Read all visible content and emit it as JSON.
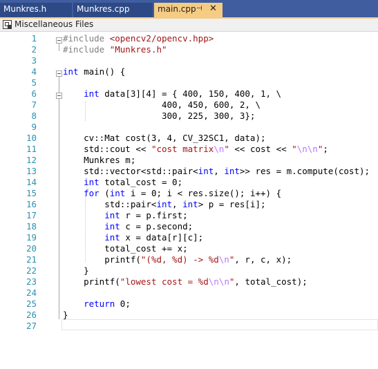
{
  "tabs": [
    {
      "label": "Munkres.h",
      "active": false
    },
    {
      "label": "Munkres.cpp",
      "active": false
    },
    {
      "label": "main.cpp",
      "active": true
    }
  ],
  "active_tab": {
    "pin_icon": "pin-icon",
    "close_icon": "close-icon"
  },
  "navbar": {
    "label": "Miscellaneous Files",
    "icon": "solution-files-icon"
  },
  "colors": {
    "tabbar": "#3f5d9f",
    "active_tab": "#f5cc84",
    "line_numbers": "#2b91af",
    "keyword": "#0000ff",
    "string": "#a31515",
    "escape": "#b776fb"
  },
  "editor": {
    "line_numbers": [
      "1",
      "2",
      "3",
      "4",
      "5",
      "6",
      "7",
      "8",
      "9",
      "10",
      "11",
      "12",
      "13",
      "14",
      "15",
      "16",
      "17",
      "18",
      "19",
      "20",
      "21",
      "22",
      "23",
      "24",
      "25",
      "26",
      "27"
    ],
    "lines": [
      "#include <opencv2/opencv.hpp>",
      "#include \"Munkres.h\"",
      "",
      "int main() {",
      "",
      "    int data[3][4] = { 400, 150, 400, 1, \\",
      "                   400, 450, 600, 2, \\",
      "                   300, 225, 300, 3};",
      "",
      "    cv::Mat cost(3, 4, CV_32SC1, data);",
      "    std::cout << \"cost matrix\\n\" << cost << \"\\n\\n\";",
      "    Munkres m;",
      "    std::vector<std::pair<int, int>> res = m.compute(cost);",
      "    int total_cost = 0;",
      "    for (int i = 0; i < res.size(); i++) {",
      "        std::pair<int, int> p = res[i];",
      "        int r = p.first;",
      "        int c = p.second;",
      "        int x = data[r][c];",
      "        total_cost += x;",
      "        printf(\"(%d, %d) -> %d\\n\", r, c, x);",
      "    }",
      "    printf(\"lowest cost = %d\\n\\n\", total_cost);",
      "",
      "    return 0;",
      "}",
      ""
    ]
  }
}
